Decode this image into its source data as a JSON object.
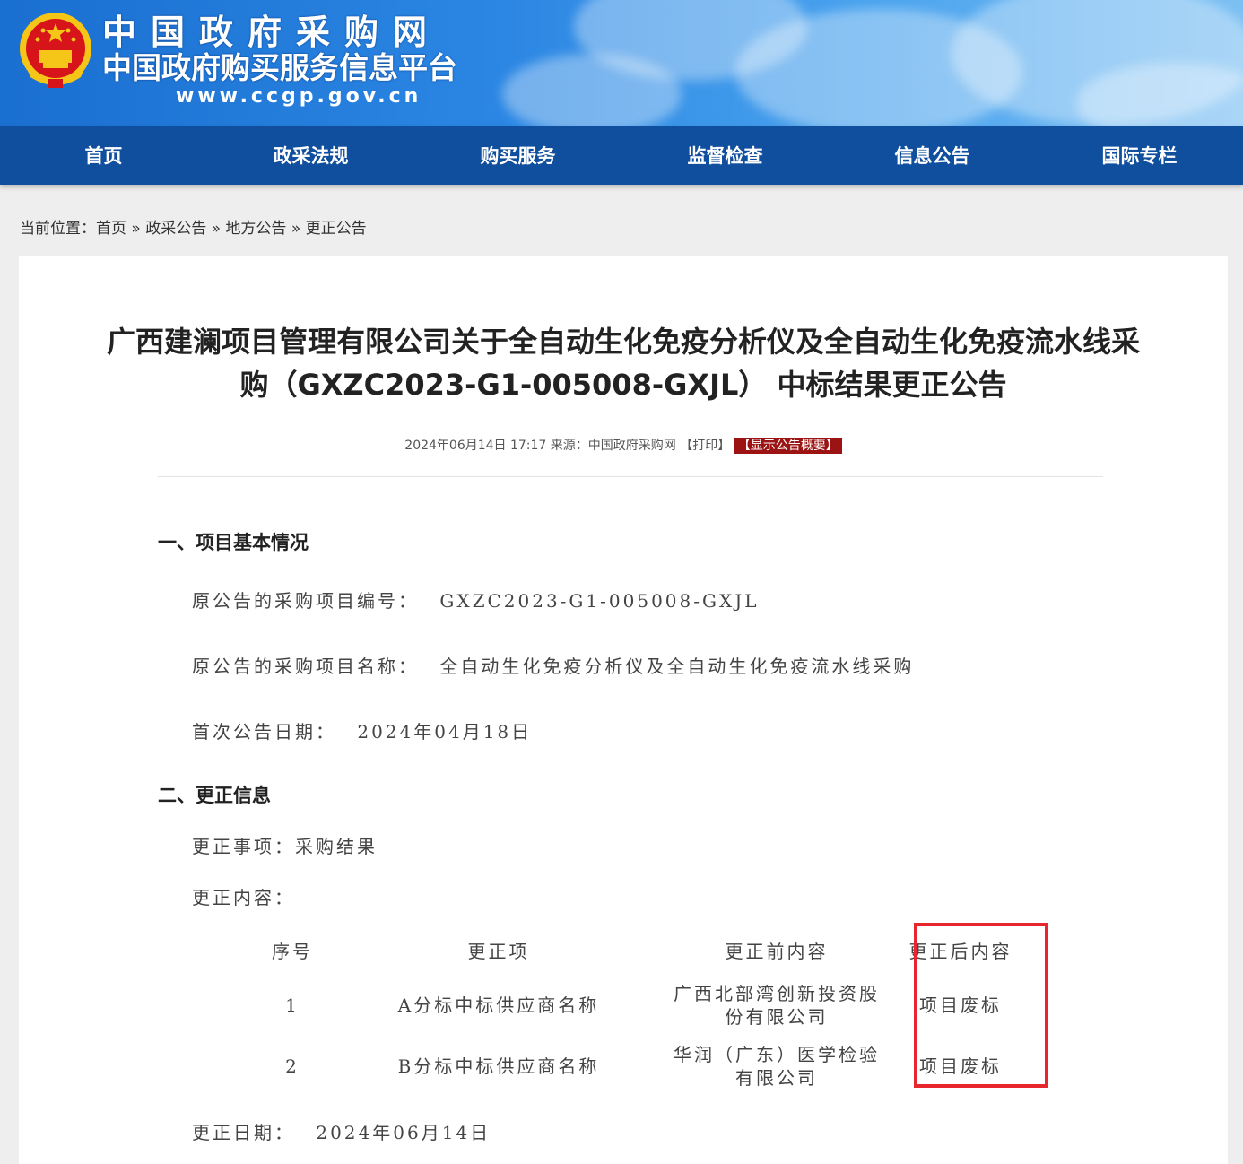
{
  "header": {
    "site_name": "中国政府采购网",
    "site_subtitle": "中国政府购买服务信息平台",
    "site_url": "www.ccgp.gov.cn"
  },
  "nav": {
    "items": [
      {
        "label": "首页"
      },
      {
        "label": "政采法规"
      },
      {
        "label": "购买服务"
      },
      {
        "label": "监督检查"
      },
      {
        "label": "信息公告"
      },
      {
        "label": "国际专栏"
      }
    ]
  },
  "breadcrumb": {
    "prefix": "当前位置：",
    "items": [
      {
        "label": "首页"
      },
      {
        "label": "政采公告"
      },
      {
        "label": "地方公告"
      },
      {
        "label": "更正公告"
      }
    ],
    "separator": "»"
  },
  "article": {
    "title_line1": "广西建澜项目管理有限公司关于全自动生化免疫分析仪及全自动生化免疫流水线采",
    "title_line2": "购（GXZC2023-G1-005008-GXJL） 中标结果更正公告",
    "meta_date": "2024年06月14日 17:17",
    "meta_source_label": "来源：",
    "meta_source": "中国政府采购网",
    "meta_print": "【打印】",
    "meta_summary": "【显示公告概要】",
    "section1_title": "一、项目基本情况",
    "project_no_label": "原公告的采购项目编号：",
    "project_no": "GXZC2023-G1-005008-GXJL",
    "project_name_label": "原公告的采购项目名称：",
    "project_name": "全自动生化免疫分析仪及全自动生化免疫流水线采购",
    "first_date_label": "首次公告日期：",
    "first_date": "2024年04月18日",
    "section2_title": "二、更正信息",
    "correction_item_label": "更正事项：",
    "correction_item": "采购结果",
    "correction_content_label": "更正内容：",
    "table": {
      "headers": [
        "序号",
        "更正项",
        "更正前内容",
        "更正后内容"
      ],
      "rows": [
        {
          "no": "1",
          "item": "A分标中标供应商名称",
          "before_1": "广西北部湾创新投资股",
          "before_2": "份有限公司",
          "after": "项目废标"
        },
        {
          "no": "2",
          "item": "B分标中标供应商名称",
          "before_1": "华润（广东）医学检验",
          "before_2": "有限公司",
          "after": "项目废标"
        }
      ]
    },
    "correction_date_label": "更正日期：",
    "correction_date": "2024年06月14日"
  },
  "colors": {
    "nav_bg": "#104e9e",
    "highlight_border": "#e8262d",
    "summary_bg": "#9b1313"
  }
}
